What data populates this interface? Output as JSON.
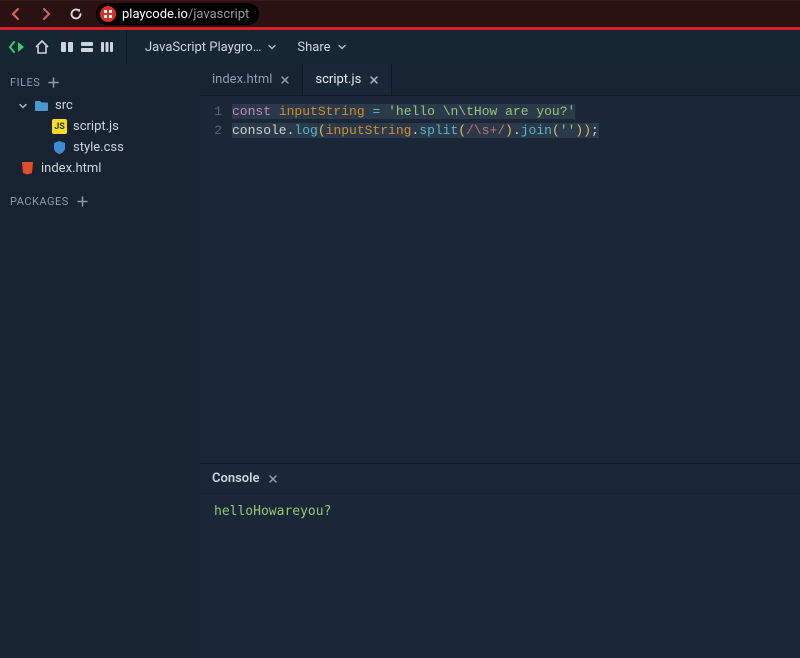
{
  "browser": {
    "url_host": "playcode.io",
    "url_path": "/javascript"
  },
  "appbar": {
    "project_label": "JavaScript Playgro…",
    "share_label": "Share"
  },
  "sidebar": {
    "files_header": "FILES",
    "packages_header": "PACKAGES",
    "tree": {
      "src_label": "src",
      "script_label": "script.js",
      "style_label": "style.css",
      "index_label": "index.html"
    }
  },
  "tabs": [
    {
      "label": "index.html",
      "active": false
    },
    {
      "label": "script.js",
      "active": true
    }
  ],
  "code": {
    "lines": [
      "1",
      "2"
    ],
    "l1": {
      "kw": "const",
      "var": "inputString",
      "op": "=",
      "str": "'hello \\n\\tHow are you?'"
    },
    "l2": {
      "obj": "console",
      "call1": "log",
      "arg": "inputString",
      "call2": "split",
      "regex": "/\\s+/",
      "call3": "join",
      "str": "''"
    }
  },
  "console": {
    "title": "Console",
    "output": "helloHowareyou?"
  }
}
